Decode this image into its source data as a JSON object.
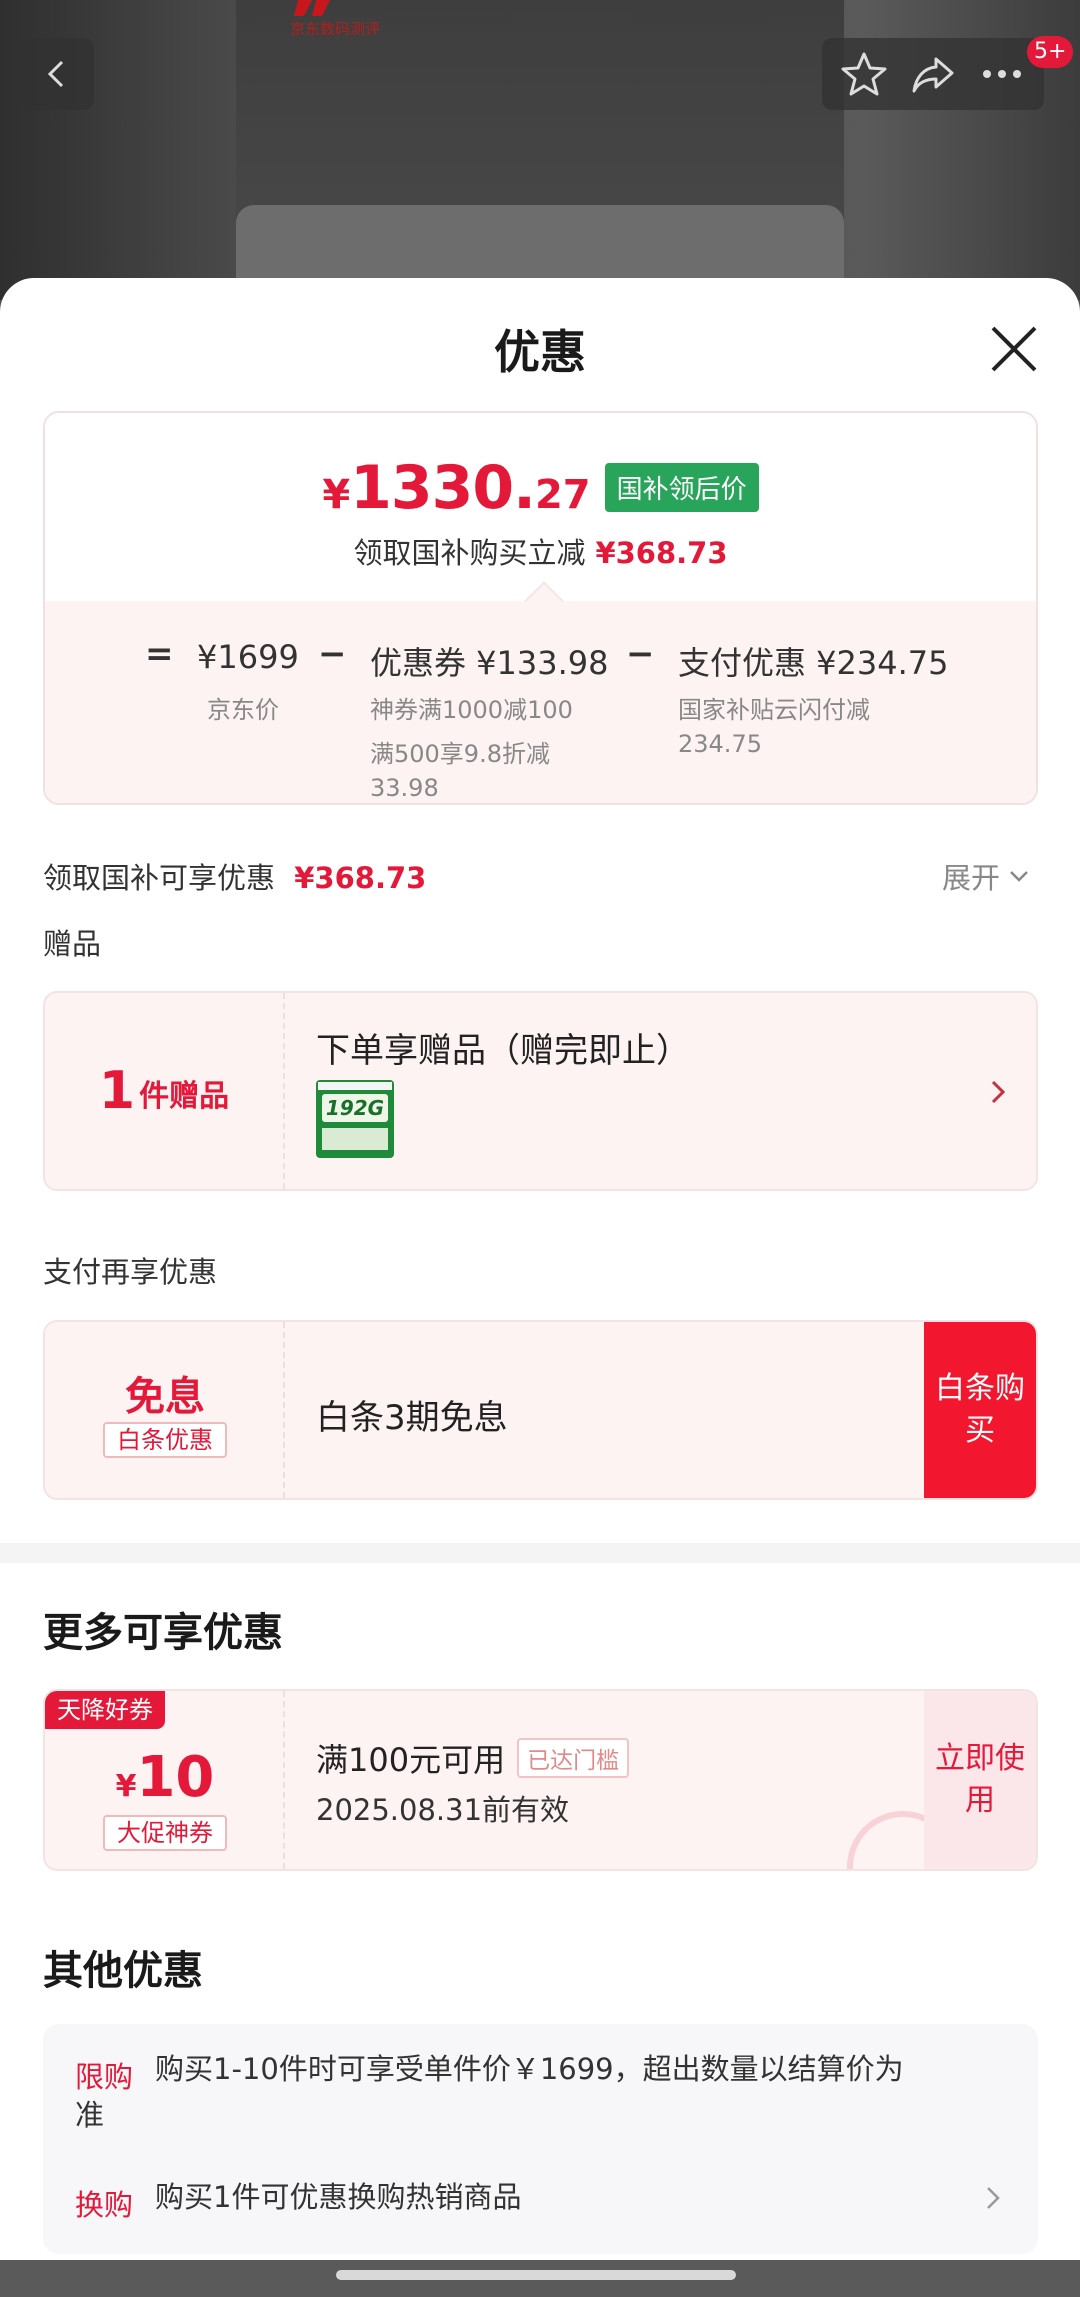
{
  "background": {
    "logo_text": "京东数码测评",
    "notification_count": "5+"
  },
  "sheet": {
    "title": "优惠"
  },
  "price_card": {
    "currency": "¥",
    "price_int": "1330.",
    "price_dec": "27",
    "tag": "国补领后价",
    "sub_label": "领取国补购买立减",
    "sub_amount": "¥368.73",
    "op_equal": "=",
    "jd_price": "¥1699",
    "jd_price_label": "京东价",
    "op_minus_1": "−",
    "coupon_title": "优惠券 ¥133.98",
    "coupon_detail_1": "神券满1000减100",
    "coupon_detail_2": "满500享9.8折减",
    "coupon_detail_3": "33.98",
    "op_minus_2": "−",
    "pay_title": "支付优惠 ¥234.75",
    "pay_detail_1": "国家补贴云闪付减",
    "pay_detail_2": "234.75"
  },
  "summary": {
    "label": "领取国补可享优惠",
    "amount": "¥368.73",
    "expand_label": "展开"
  },
  "gift": {
    "section_label": "赠品",
    "count": "1",
    "unit": "件赠品",
    "title": "下单享赠品（赠完即止）",
    "image_text": "192G"
  },
  "pay_more": {
    "section_label": "支付再享优惠",
    "big": "免息",
    "tag": "白条优惠",
    "title": "白条3期免息",
    "button": "白条购买"
  },
  "more": {
    "section_title": "更多可享优惠",
    "ribbon": "天降好券",
    "currency": "¥",
    "value": "10",
    "tag": "大促神券",
    "title": "满100元可用",
    "reach_tag": "已达门槛",
    "date": "2025.08.31前有效",
    "button": "立即使用"
  },
  "other": {
    "section_title": "其他优惠",
    "item1_label": "限购",
    "item1_text_line1": "购买1-10件时可享受单件价￥1699，超出数量以结算价为",
    "item1_text_line2": "准",
    "item2_label": "换购",
    "item2_text": "购买1件可优惠换购热销商品"
  },
  "colors": {
    "accent_red": "#e4193a",
    "green_tag": "#29a55b",
    "card_bg": "#fdf3f3"
  }
}
